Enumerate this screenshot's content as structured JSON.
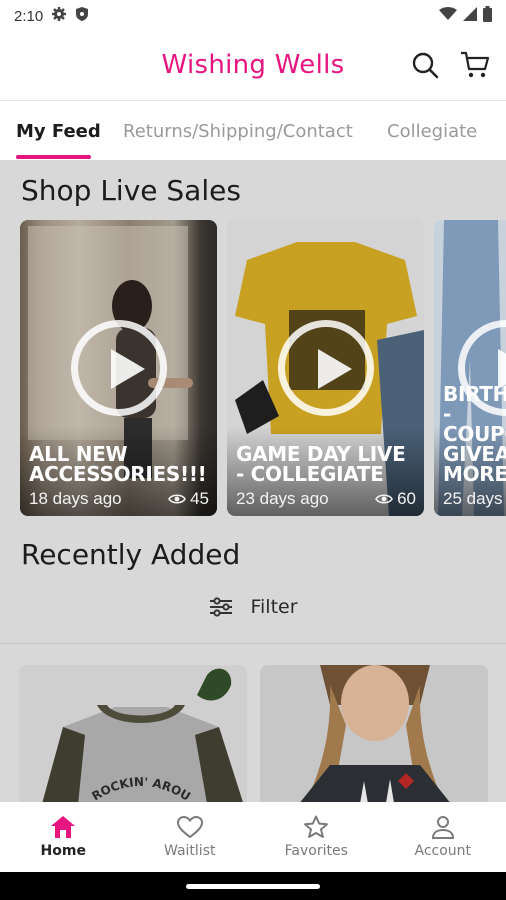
{
  "status_bar": {
    "time": "2:10",
    "left_icons": [
      "gear-icon",
      "shield-icon"
    ],
    "right_icons": [
      "wifi-icon",
      "signal-icon",
      "battery-icon"
    ]
  },
  "header": {
    "title": "Wishing Wells",
    "title_color": "#e6157f"
  },
  "tabs": [
    {
      "label": "My Feed",
      "active": true
    },
    {
      "label": "Returns/Shipping/Contact",
      "active": false
    },
    {
      "label": "Collegiate",
      "active": false
    }
  ],
  "live_sales": {
    "heading": "Shop Live Sales",
    "cards": [
      {
        "title": "ALL NEW ACCESSORIES!!!",
        "age": "18 days ago",
        "views": "45"
      },
      {
        "title": "GAME DAY LIVE - COLLEGIATE",
        "age": "23 days ago",
        "views": "60"
      },
      {
        "title": "BIRTHD - Coupo Giveaw More!",
        "age": "25 days",
        "views": ""
      }
    ]
  },
  "recent": {
    "heading": "Recently Added",
    "filter_label": "Filter",
    "products": [
      {
        "text": "ROCKIN' AROUND"
      },
      {
        "text": ""
      }
    ]
  },
  "bottom_nav": [
    {
      "label": "Home",
      "icon": "home-icon",
      "active": true
    },
    {
      "label": "Waitlist",
      "icon": "heart-icon",
      "active": false
    },
    {
      "label": "Favorites",
      "icon": "star-icon",
      "active": false
    },
    {
      "label": "Account",
      "icon": "person-icon",
      "active": false
    }
  ],
  "colors": {
    "accent": "#e6157f",
    "overlay": "#d8d8d8"
  }
}
